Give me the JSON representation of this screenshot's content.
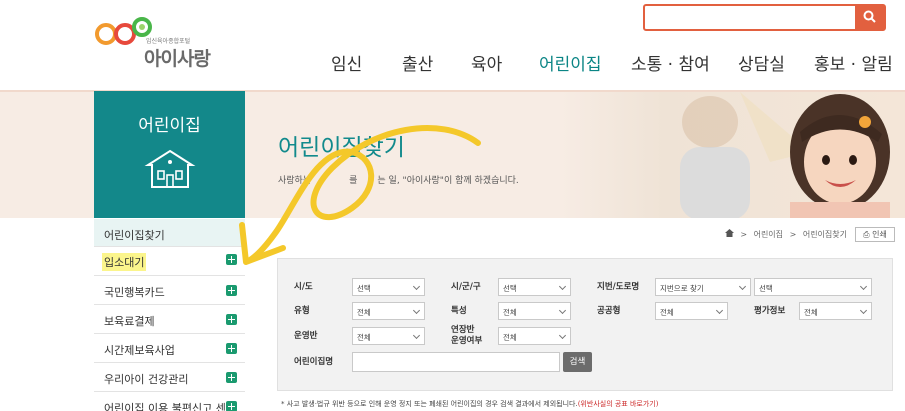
{
  "header": {
    "logo_sub": "임신육아종합포털",
    "logo_name": "아이사랑",
    "search_value": "",
    "gnb": [
      "임신",
      "출산",
      "육아",
      "어린이집",
      "소통 · 참여",
      "상담실",
      "홍보 · 알림"
    ],
    "gnb_active_index": 3
  },
  "banner": {
    "section": "어린이집",
    "title": "어린이집찾기",
    "subtitle_a": "사랑하는",
    "subtitle_b": "를",
    "subtitle_c": "는 일, \"아이사랑\"이 함께 하겠습니다."
  },
  "menu": {
    "head": "어린이집찾기",
    "items": [
      "입소대기",
      "국민행복카드",
      "보육료결제",
      "시간제보육사업",
      "우리아이 건강관리",
      "어린이집 이용 불편신고 센터"
    ]
  },
  "breadcrumb": {
    "home_icon": "home-icon",
    "items": [
      "어린이집",
      "어린이집찾기"
    ],
    "print": "인쇄"
  },
  "form": {
    "row1": [
      {
        "label": "시/도",
        "value": "선택"
      },
      {
        "label": "시/군/구",
        "value": "선택"
      },
      {
        "label": "지번/도로명",
        "value": "지번으로 찾기",
        "value2": "선택"
      }
    ],
    "row2": [
      {
        "label": "유형",
        "value": "전체"
      },
      {
        "label": "특성",
        "value": "전체"
      },
      {
        "label": "공공형",
        "value": "전체"
      },
      {
        "label": "평가정보",
        "value": "전체"
      }
    ],
    "row3": [
      {
        "label": "운영반",
        "value": "전체"
      },
      {
        "label_l1": "연장반",
        "label_l2": "운영여부",
        "value": "전체"
      }
    ],
    "name_label": "어린이집명",
    "name_value": "",
    "search_button": "검색"
  },
  "notice": {
    "text": "* 사고 발생·법규 위반 등으로 인해 운영 정지 또는 폐쇄된 어린이집의 경우 검색 결과에서 제외됩니다.",
    "link": "(위반사실의 공표 바로가기)"
  },
  "colors": {
    "teal": "#13888a",
    "accent": "#e2603f",
    "highlight": "#fbf58c",
    "annotation": "#f4c82a"
  }
}
